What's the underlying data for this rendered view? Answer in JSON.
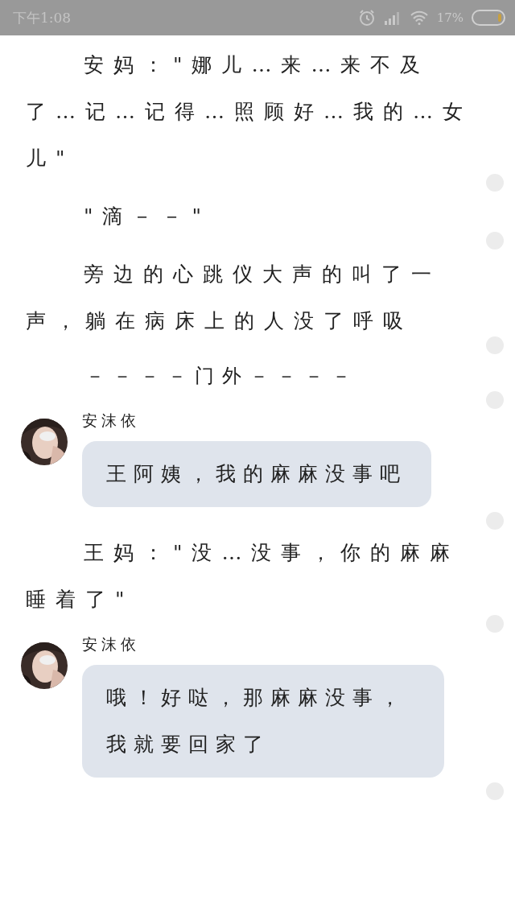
{
  "status_bar": {
    "time": "下午1:08",
    "battery_text": "17%"
  },
  "blocks": [
    {
      "kind": "paragraph",
      "text": "安妈：\"娜儿…来…来不及了…记…记得…照顾好…我的…女儿\""
    },
    {
      "kind": "paragraph",
      "text": "\"滴－－\""
    },
    {
      "kind": "paragraph",
      "text": "旁边的心跳仪大声的叫了一声，躺在病床上的人没了呼吸"
    },
    {
      "kind": "divider",
      "text": "－－－－门外－－－－"
    },
    {
      "kind": "message",
      "name": "安沫依",
      "text": "王阿姨，我的麻麻没事吧"
    },
    {
      "kind": "paragraph",
      "text": "王妈：\"没…没事，你的麻麻睡着了\""
    },
    {
      "kind": "message",
      "name": "安沫依",
      "text": "哦！好哒，那麻麻没事，我就要回家了"
    }
  ]
}
